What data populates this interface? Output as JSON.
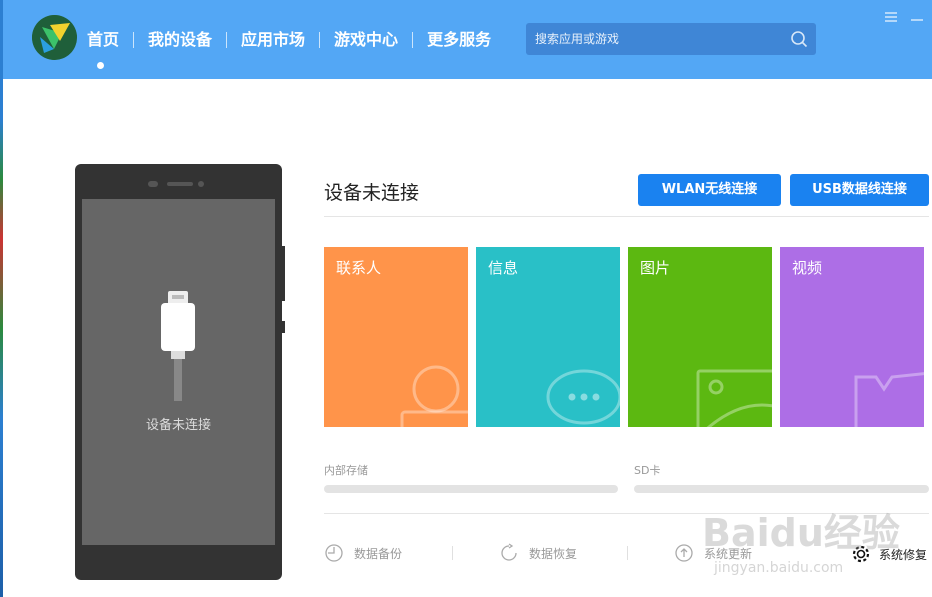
{
  "header": {
    "nav": [
      "首页",
      "我的设备",
      "应用市场",
      "游戏中心",
      "更多服务"
    ],
    "active_index": 0,
    "search_placeholder": "搜索应用或游戏"
  },
  "phone": {
    "status": "设备未连接"
  },
  "main": {
    "title": "设备未连接",
    "buttons": {
      "wlan": "WLAN无线连接",
      "usb": "USB数据线连接"
    },
    "tiles": [
      {
        "label": "联系人",
        "color": "#ff944a",
        "icon": "contact-icon"
      },
      {
        "label": "信息",
        "color": "#29c0c7",
        "icon": "message-icon"
      },
      {
        "label": "图片",
        "color": "#5cb811",
        "icon": "picture-icon"
      },
      {
        "label": "视频",
        "color": "#ad6ee6",
        "icon": "video-icon"
      }
    ],
    "storage": {
      "internal": "内部存储",
      "sd": "SD卡"
    },
    "tools": {
      "backup": "数据备份",
      "restore": "数据恢复",
      "update": "系统更新",
      "repair": "系统修复"
    }
  },
  "watermark": {
    "text": "Baidu经验",
    "url": "jingyan.baidu.com"
  },
  "colors": {
    "header": "#53a7f5",
    "accent": "#1a82f0",
    "phone_body": "#333333",
    "phone_screen": "#666666"
  }
}
